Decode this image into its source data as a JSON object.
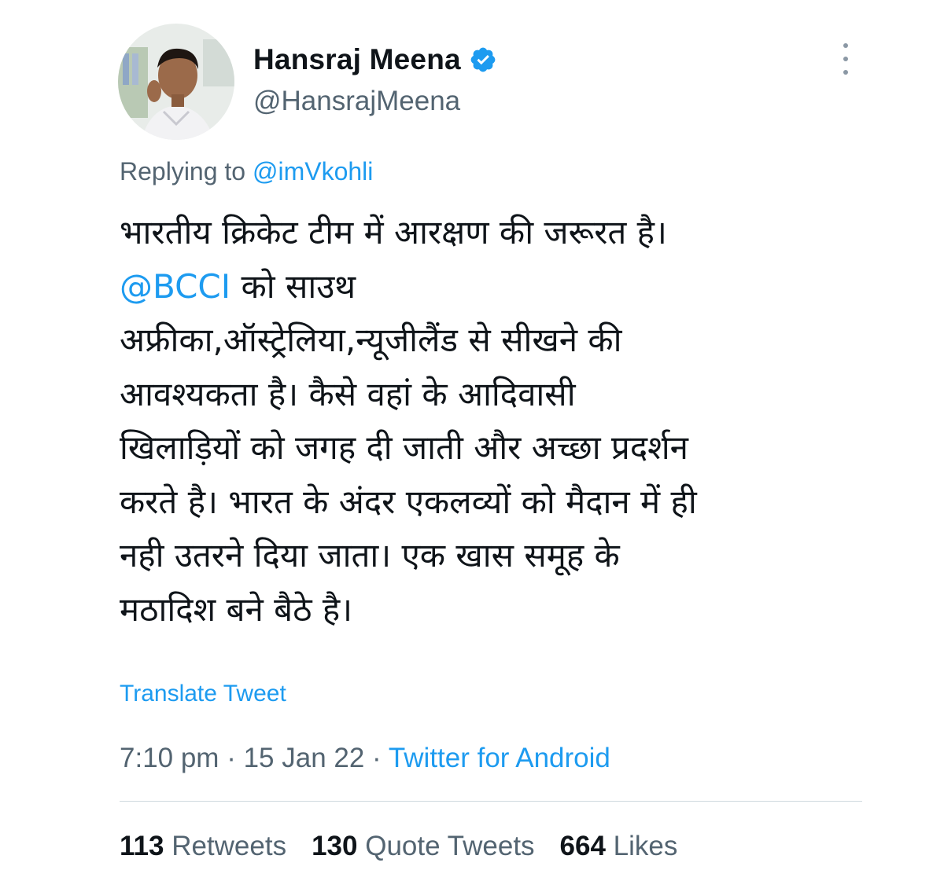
{
  "author": {
    "display_name": "Hansraj Meena",
    "handle": "@HansrajMeena",
    "verified": true
  },
  "reply": {
    "prefix": "Replying to",
    "mention": "@imVkohli"
  },
  "tweet": {
    "line1": "भारतीय क्रिकेट टीम में आरक्षण की जरूरत है।",
    "line2_mention": "@BCCI",
    "line2_text": " को साउथ",
    "line3": "अफ्रीका,ऑस्ट्रेलिया,न्यूजीलैंड से सीखने की",
    "line4": "आवश्यकता है। कैसे वहां के आदिवासी",
    "line5": "खिलाड़ियों को जगह दी जाती और अच्छा प्रदर्शन",
    "line6": "करते है। भारत के अंदर एकलव्यों को मैदान में ही",
    "line7": "नही उतरने दिया जाता। एक खास समूह के",
    "line8": "मठादिश बने बैठे है।"
  },
  "translate_label": "Translate Tweet",
  "meta": {
    "time": "7:10 pm",
    "separator": " · ",
    "date": "15 Jan 22",
    "source": "Twitter for Android"
  },
  "stats": {
    "retweets_count": "113",
    "retweets_label": " Retweets",
    "quotes_count": "130",
    "quotes_label": " Quote Tweets",
    "likes_count": "664",
    "likes_label": " Likes"
  },
  "colors": {
    "accent": "#1d9bf0",
    "text": "#0f1419",
    "muted": "#536471",
    "divider": "#cfd9de"
  },
  "icons": {
    "verified": "verified-badge-icon",
    "more": "more-options-icon"
  }
}
